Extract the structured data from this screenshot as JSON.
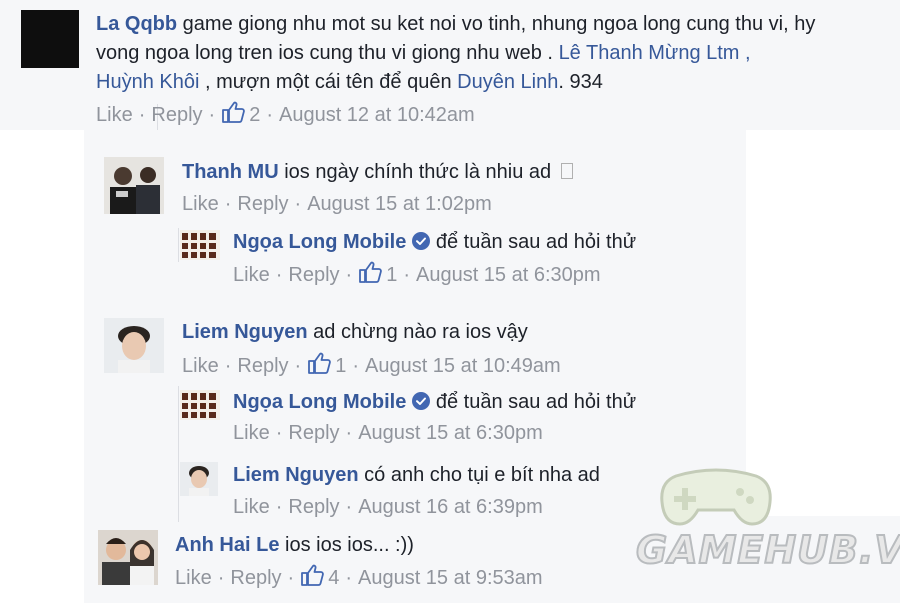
{
  "colors": {
    "name": "#365899",
    "text": "#1d2129",
    "meta": "#90949c",
    "thread_bg": "#f6f7f9",
    "verified": "#4267b2"
  },
  "actions": {
    "like": "Like",
    "reply": "Reply"
  },
  "comments": [
    {
      "author": "La Qqbb",
      "text_line1": "game giong nhu mot su ket noi vo tinh, nhung ngoa long cung thu vi, hy",
      "text_line2a": "vong ngoa long tren ios cung thu vi giong nhu web . ",
      "tag1": "Lê Thanh Mừng Ltm",
      "tag1_suffix": " ,",
      "tag2": "Huỳnh Khôi",
      "text_line3a": " , mượn một cái tên để quên ",
      "tag3": "Duyên Linh",
      "text_line3b": ". 934",
      "likes": "2",
      "timestamp": "August 12 at 10:42am"
    },
    {
      "author": "Thanh MU",
      "text": "ios ngày chính thức là nhiu ad",
      "timestamp": "August 15 at 1:02pm"
    },
    {
      "author": "Ngọa Long Mobile",
      "text": "để tuần sau ad hỏi thử",
      "likes": "1",
      "timestamp": "August 15 at 6:30pm"
    },
    {
      "author": "Liem Nguyen",
      "text": "ad chừng nào ra ios vậy",
      "likes": "1",
      "timestamp": "August 15 at 10:49am"
    },
    {
      "author": "Ngọa Long Mobile",
      "text": "để tuần sau ad hỏi thử",
      "timestamp": "August 15 at 6:30pm"
    },
    {
      "author": "Liem Nguyen",
      "text": "có anh cho tụi e bít nha ad",
      "timestamp": "August 16 at 6:39pm"
    },
    {
      "author": "Anh Hai Le",
      "text": "ios ios ios... :))",
      "likes": "4",
      "timestamp": "August 15 at 9:53am"
    }
  ],
  "watermark": {
    "text": "GAMEHUB.VN",
    "icon": "gamepad-icon"
  }
}
